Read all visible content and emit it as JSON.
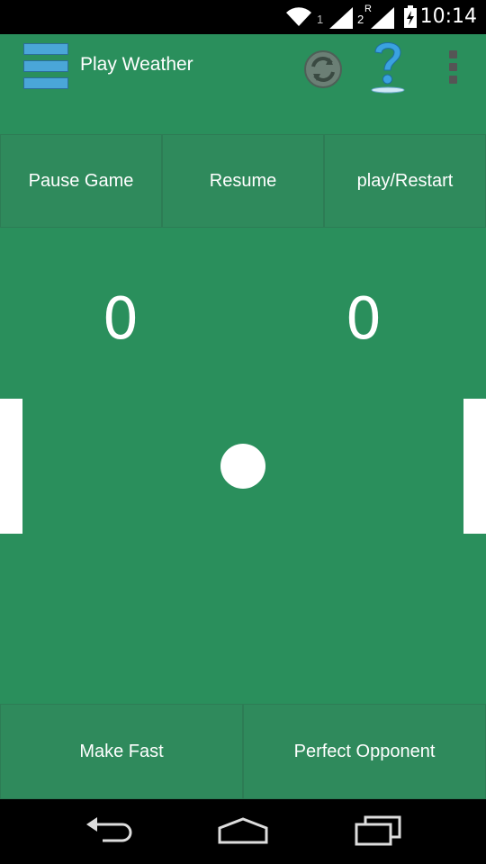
{
  "status_bar": {
    "time": "10:14",
    "sim1": "1",
    "sim2": "2",
    "roaming": "R",
    "icons": [
      "wifi-icon",
      "signal-icon",
      "signal-roaming-icon",
      "battery-charging-icon"
    ]
  },
  "app_bar": {
    "title": "Play Weather",
    "icons": [
      "menu-icon",
      "refresh-icon",
      "help-icon",
      "overflow-menu-icon"
    ]
  },
  "controls": {
    "pause_label": "Pause Game",
    "resume_label": "Resume",
    "restart_label": "play/Restart",
    "fast_label": "Make Fast",
    "perfect_label": "Perfect Opponent"
  },
  "game": {
    "score_left": "0",
    "score_right": "0"
  },
  "nav_bar": {
    "icons": [
      "back-icon",
      "home-icon",
      "recents-icon"
    ]
  },
  "colors": {
    "background": "#2a8f5c",
    "button": "#2f8a5c",
    "menu_accent": "#4aa6d8",
    "help_accent": "#3aa2e0"
  }
}
